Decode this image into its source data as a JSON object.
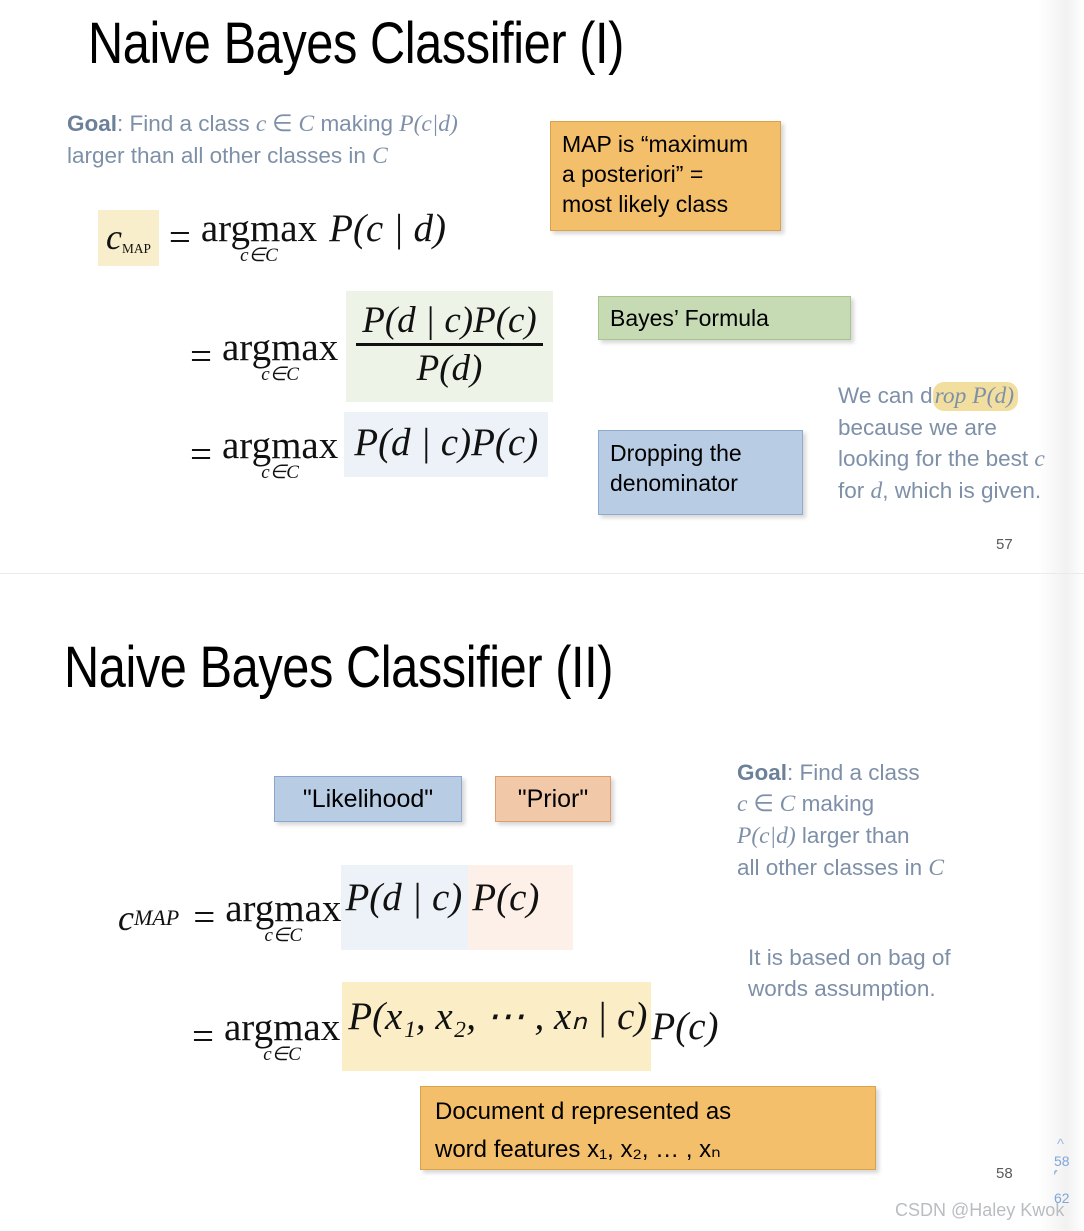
{
  "slide1": {
    "title": "Naive Bayes Classifier (I)",
    "goal": {
      "label": "Goal",
      "line1_a": ": Find a class ",
      "var_c": "c",
      "elem": " ∈ ",
      "var_C": "C",
      "line1_b": " making ",
      "prob": "P(c|d)",
      "line2": "larger than all other classes in ",
      "line2_C": "C"
    },
    "callouts": {
      "map": [
        "MAP is “maximum",
        "a posteriori”  =",
        "most likely class"
      ],
      "bayes": "Bayes’ Formula",
      "dropping": [
        "Dropping the",
        "denominator"
      ]
    },
    "drop_note": {
      "pre": "We can d",
      "highlight": "rop P(d)",
      "line2": "because we are",
      "line3_a": "looking for the best ",
      "line3_c": "c",
      "line4_a": "for ",
      "line4_d": "d",
      "line4_b": ", which is given."
    },
    "math": {
      "cmap": "c",
      "cmap_sub": "MAP",
      "eq": "=",
      "argmax": "argmax",
      "argmax_sub": "c∈C",
      "line1_expr": "P(c | d)",
      "line2_num": "P(d | c)P(c)",
      "line2_den": "P(d)",
      "line3_expr": "P(d | c)P(c)"
    },
    "page_number": "57"
  },
  "slide2": {
    "title": "Naive Bayes Classifier (II)",
    "callouts": {
      "likelihood": "\"Likelihood\"",
      "prior": "\"Prior\"",
      "document": [
        "Document d represented as",
        "word features x₁, x₂, … , xₙ"
      ]
    },
    "goal": {
      "label": "Goal",
      "line1": ": Find a class",
      "line2_c": "c",
      "line2_elem": " ∈ ",
      "line2_C": "C",
      "line2_rest": " making",
      "line3_prob": "P(c|d)",
      "line3_rest": " larger than",
      "line4": "all other classes in ",
      "line4_C": "C"
    },
    "bag_words": [
      "It is based on bag of",
      "words assumption."
    ],
    "math": {
      "cmap": "c",
      "cmap_sub": "MAP",
      "eq": "=",
      "argmax": "argmax",
      "argmax_sub": "c∈C",
      "line1_likelihood": "P(d | c)",
      "line1_prior": "P(c)",
      "line2_joint": "P(x₁, x₂, ⋯ , xₙ | c)",
      "line2_prior": "P(c)"
    },
    "page_number": "58"
  },
  "watermark": "CSDN @Haley Kwok",
  "pager": {
    "current": "58",
    "total": "62"
  },
  "colors": {
    "accent_orange": "#f3bf6a",
    "accent_green": "#c6dbb4",
    "accent_blue": "#b8cce4",
    "accent_peach": "#f2c9a8",
    "text_slate": "#7e90a8",
    "highlight_yellow": "#f2dfa0"
  }
}
